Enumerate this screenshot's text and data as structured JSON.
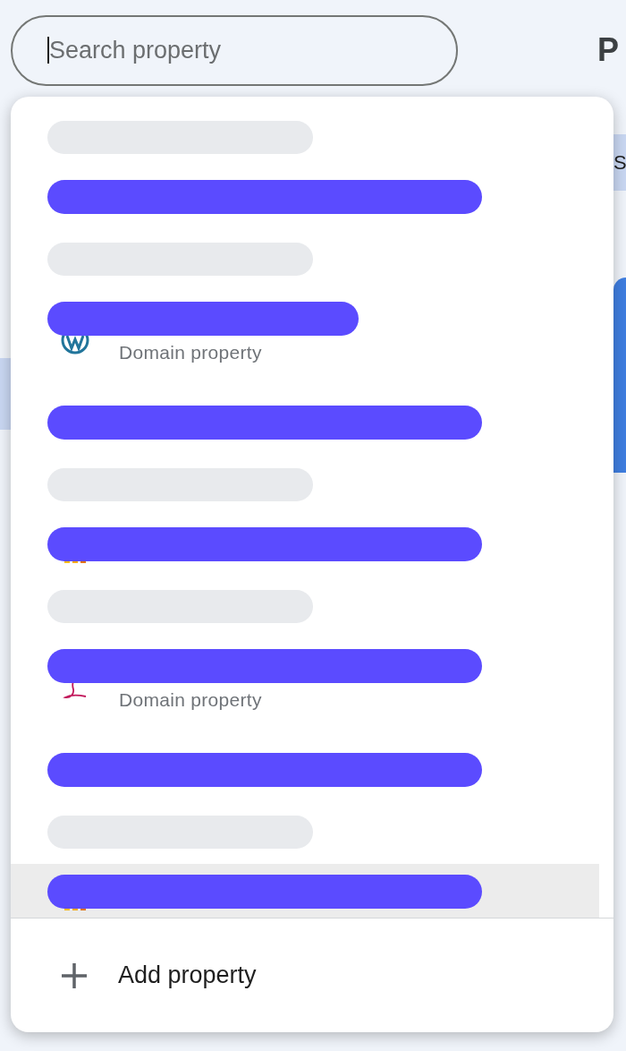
{
  "search": {
    "placeholder": "Search property",
    "focused": true
  },
  "page_heading": "P",
  "side_tab": "S",
  "property_list": [
    {
      "kind": "header"
    },
    {
      "kind": "property",
      "highlighted": false
    },
    {
      "kind": "header"
    },
    {
      "kind": "wordpress",
      "subtitle": "Domain property",
      "highlighted": false
    },
    {
      "kind": "property",
      "highlighted": false
    },
    {
      "kind": "header"
    },
    {
      "kind": "chart",
      "highlighted": false
    },
    {
      "kind": "header"
    },
    {
      "kind": "script",
      "subtitle": "Domain property",
      "highlighted": false
    },
    {
      "kind": "property",
      "highlighted": false
    },
    {
      "kind": "header"
    },
    {
      "kind": "chart",
      "highlighted": true
    }
  ],
  "add_property": "Add property"
}
